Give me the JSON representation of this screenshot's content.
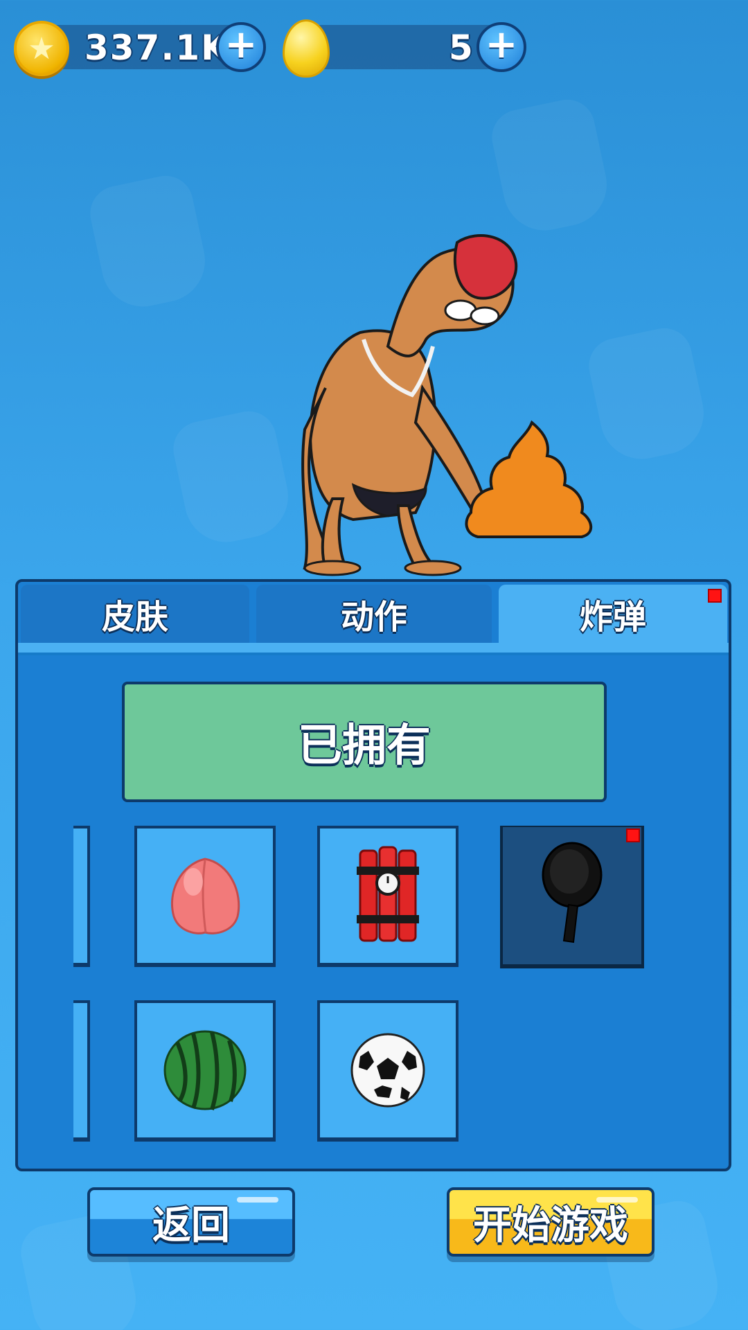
{
  "currency": {
    "coins": {
      "value": "337.1K",
      "icon": "gold-star-coin-icon"
    },
    "eggs": {
      "value": "5",
      "icon": "golden-egg-icon"
    },
    "plus_symbol": "+"
  },
  "tabs": [
    {
      "label": "皮肤",
      "active": false
    },
    {
      "label": "动作",
      "active": false
    },
    {
      "label": "炸弹",
      "active": true,
      "notification": true
    }
  ],
  "owned_banner": {
    "label": "已拥有"
  },
  "items": [
    {
      "name": "peach",
      "icon": "peach-icon"
    },
    {
      "name": "dynamite",
      "icon": "dynamite-icon"
    },
    {
      "name": "frying-pan",
      "icon": "frying-pan-icon",
      "selected": true,
      "notification": true
    },
    {
      "name": "watermelon",
      "icon": "watermelon-icon"
    },
    {
      "name": "soccer-ball",
      "icon": "soccer-ball-icon"
    }
  ],
  "buttons": {
    "back": "返回",
    "start": "开始游戏"
  },
  "colors": {
    "background": "#3ba6ec",
    "panel": "#1b7fd3",
    "active_tab": "#4bb1f3",
    "owned_banner": "#6ec89a",
    "start_button": "#f8b91a",
    "notification": "#ff1313"
  }
}
